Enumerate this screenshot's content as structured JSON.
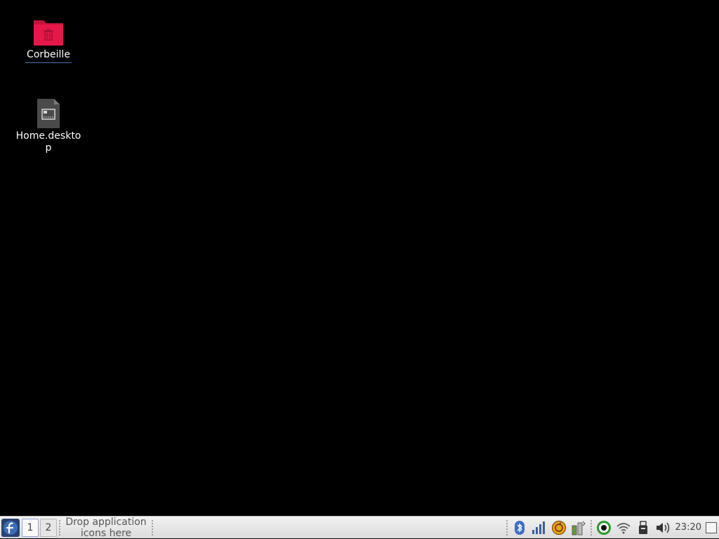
{
  "desktop": {
    "icons": [
      {
        "label": "Corbeille",
        "icon": "trash-folder-icon"
      },
      {
        "label": "Home.desktop",
        "icon": "desktop-file-icon"
      }
    ]
  },
  "taskbar": {
    "start_icon": "fedora-logo-icon",
    "workspaces": [
      "1",
      "2"
    ],
    "launcher_hint": "Drop application icons here",
    "tray": [
      "bluetooth-icon",
      "network-monitor-icon",
      "update-icon",
      "battery-icon",
      "record-icon",
      "wifi-icon",
      "usb-icon",
      "volume-icon"
    ],
    "clock": "23:20"
  },
  "colors": {
    "desktop_bg": "#000000",
    "folder_red": "#e8174a",
    "taskbar_bg": "#e6e6e6",
    "fedora_blue": "#294172"
  }
}
